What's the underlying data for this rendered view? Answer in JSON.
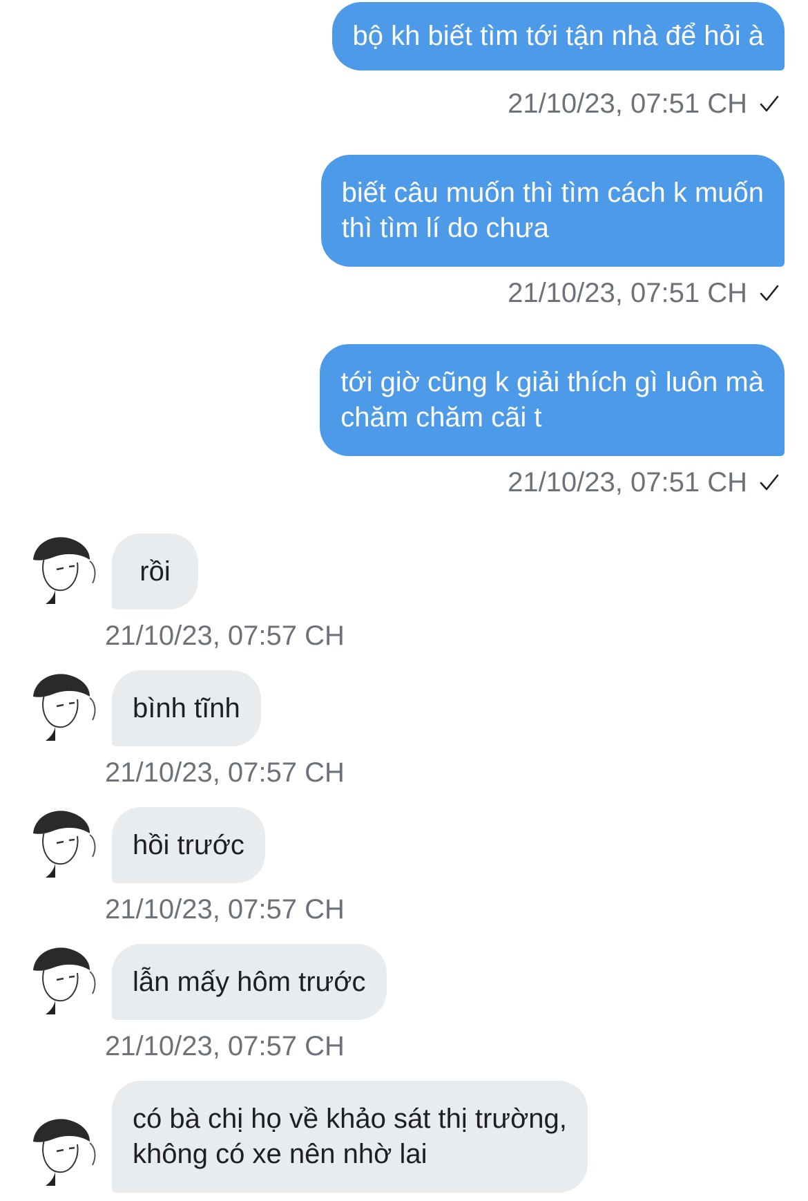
{
  "chat": {
    "sent": [
      {
        "text": "bộ kh biết tìm tới tận nhà để hỏi à",
        "time": "21/10/23, 07:51 CH"
      },
      {
        "text": "biết câu muốn thì tìm cách k muốn\nthì tìm lí do chưa",
        "time": "21/10/23, 07:51 CH"
      },
      {
        "text": "tới giờ cũng k giải thích gì luôn mà\nchăm chăm cãi t",
        "time": "21/10/23, 07:51 CH"
      }
    ],
    "received": [
      {
        "text": "rồi",
        "time": "21/10/23, 07:57 CH"
      },
      {
        "text": "bình tĩnh",
        "time": "21/10/23, 07:57 CH"
      },
      {
        "text": "hồi trước",
        "time": "21/10/23, 07:57 CH"
      },
      {
        "text": "lẫn mấy hôm trước",
        "time": "21/10/23, 07:57 CH"
      },
      {
        "text": "có bà chị họ về khảo sát thị trường,\nkhông có xe nên nhờ lai",
        "time": ""
      }
    ],
    "status_icon": "check-icon",
    "colors": {
      "outgoing_bubble": "#4d9be8",
      "incoming_bubble": "#e9ecef",
      "timestamp": "#6c727a"
    }
  }
}
